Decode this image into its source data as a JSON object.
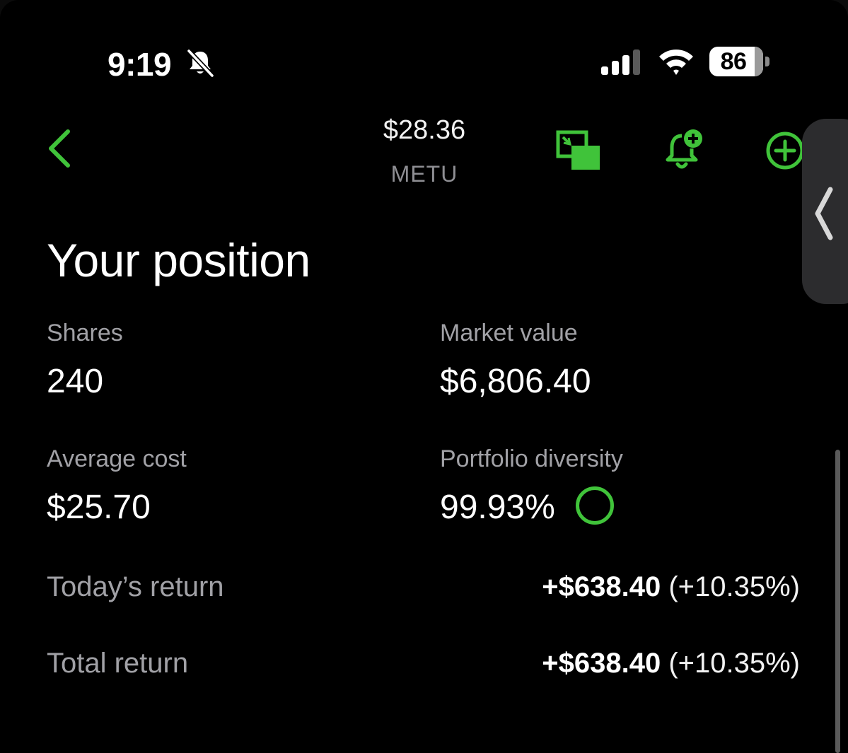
{
  "status_bar": {
    "time": "9:19",
    "battery": "86",
    "icons": [
      "bell-slash-icon",
      "signal-icon",
      "wifi-icon",
      "battery-icon"
    ]
  },
  "nav": {
    "price": "$28.36",
    "symbol": "METU",
    "icons": [
      "chevron-left-icon",
      "picture-in-picture-icon",
      "bell-plus-icon",
      "plus-circle-icon"
    ],
    "accent_color": "#40c33a"
  },
  "position": {
    "title": "Your position",
    "shares": {
      "label": "Shares",
      "value": "240"
    },
    "market_value": {
      "label": "Market value",
      "value": "$6,806.40"
    },
    "average_cost": {
      "label": "Average cost",
      "value": "$25.70"
    },
    "portfolio_diversity": {
      "label": "Portfolio diversity",
      "value": "99.93%"
    },
    "todays_return": {
      "label": "Today’s return",
      "amount": "+$638.40",
      "percent": "(+10.35%)"
    },
    "total_return": {
      "label": "Total return",
      "amount": "+$638.40",
      "percent": "(+10.35%)"
    }
  }
}
